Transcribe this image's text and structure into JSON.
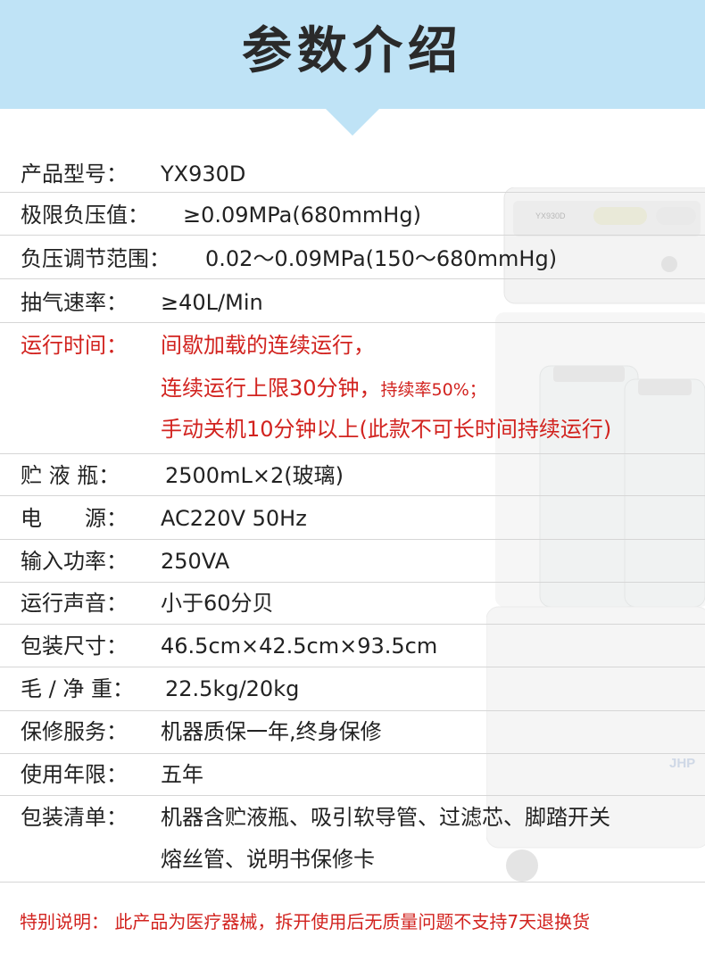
{
  "header": {
    "title": "参数介绍"
  },
  "specs": {
    "model": {
      "label": "产品型号：",
      "value": "YX930D"
    },
    "max_negative_pressure": {
      "label": "极限负压值：",
      "value": "≥0.09MPa(680mmHg)"
    },
    "pressure_range": {
      "label": "负压调节范围：",
      "value": "0.02～0.09MPa(150～680mmHg)"
    },
    "pump_rate": {
      "label": "抽气速率：",
      "value": "≥40L/Min"
    },
    "run_time": {
      "label": "运行时间：",
      "line1": "间歇加载的连续运行，",
      "line2_main": "连续运行上限30分钟，",
      "line2_small": "持续率50%；",
      "line3": "手动关机10分钟以上(此款不可长时间持续运行)"
    },
    "bottle": {
      "label": "贮 液 瓶：",
      "value": "2500mL×2(玻璃)"
    },
    "power": {
      "label": "电　　源：",
      "value": "AC220V 50Hz"
    },
    "input_power": {
      "label": "输入功率：",
      "value": "250VA"
    },
    "noise": {
      "label": "运行声音：",
      "value": "小于60分贝"
    },
    "package_size": {
      "label": "包装尺寸：",
      "value": "46.5cm×42.5cm×93.5cm"
    },
    "weight": {
      "label": "毛 / 净 重：",
      "value": "22.5kg/20kg"
    },
    "warranty": {
      "label": "保修服务：",
      "value": "机器质保一年,终身保修"
    },
    "service_life": {
      "label": "使用年限：",
      "value": "五年"
    },
    "package_list": {
      "label": "包装清单：",
      "line1": "机器含贮液瓶、吸引软导管、过滤芯、脚踏开关",
      "line2": "熔丝管、说明书保修卡"
    }
  },
  "footer": {
    "note": "特别说明：  此产品为医疗器械，拆开使用后无质量问题不支持7天退换货"
  },
  "product_image": {
    "panel_text": "YX930D",
    "logo_text": "JHP"
  },
  "colors": {
    "banner": "#bfe3f6",
    "accent_red": "#d2231f",
    "divider": "#d6d6d6"
  }
}
